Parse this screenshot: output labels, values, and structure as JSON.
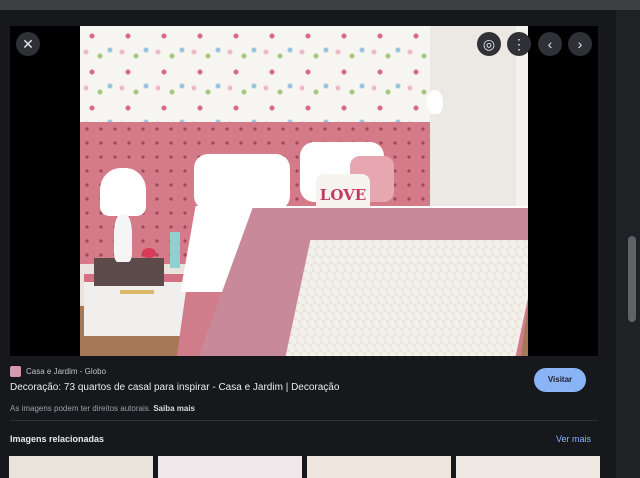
{
  "viewer": {
    "close_icon": "close-icon",
    "lens_icon": "google-lens-icon",
    "more_icon": "more-vert-icon",
    "prev_icon": "chevron-left-icon",
    "next_icon": "chevron-right-icon",
    "pillow_text": "LOVE"
  },
  "meta": {
    "source": "Casa e Jardim - Globo",
    "title": "Decoração: 73 quartos de casal para inspirar - Casa e Jardim | Decoração",
    "notice_prefix": "As imagens podem ter direitos autorais.",
    "learn_more": "Saiba mais",
    "visit_label": "Visitar",
    "accent_color": "#8ab4f8"
  },
  "related": {
    "title": "Imagens relacionadas",
    "see_more": "Ver mais"
  }
}
